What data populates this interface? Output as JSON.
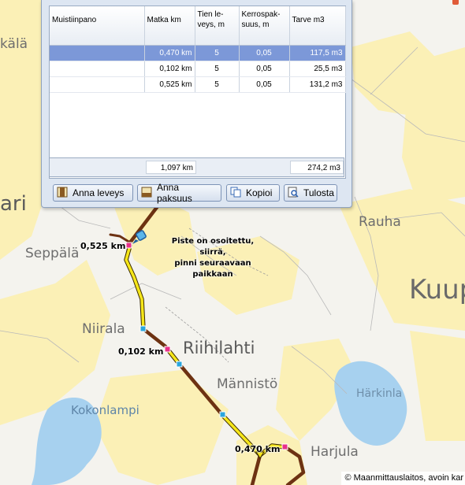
{
  "map": {
    "places": [
      {
        "id": "kala",
        "text": "kälä"
      },
      {
        "id": "ari",
        "text": "ari"
      },
      {
        "id": "seppala",
        "text": "Seppälä"
      },
      {
        "id": "rauha",
        "text": "Rauha"
      },
      {
        "id": "kuup",
        "text": "Kuup"
      },
      {
        "id": "niirala",
        "text": "Niirala"
      },
      {
        "id": "riihilahti",
        "text": "Riihilahti"
      },
      {
        "id": "mannisto",
        "text": "Männistö"
      },
      {
        "id": "harkinla",
        "text": "Härkinla"
      },
      {
        "id": "kokonlampi",
        "text": "Kokonlampi"
      },
      {
        "id": "harjula",
        "text": "Harjula"
      }
    ],
    "route_labels": {
      "a": "0,525 km",
      "b": "0,102 km",
      "c": "0,470 km"
    },
    "tooltip": {
      "line1": "Piste on osoitettu, siirrä,",
      "line2": "pinni seuraavaan paikkaan"
    },
    "copyright": "© Maanmittauslaitos, avoin kar"
  },
  "panel": {
    "columns": [
      "Muistiinpano",
      "Matka km",
      "Tien le-veys, m",
      "Kerrospak-suus, m",
      "Tarve m3"
    ],
    "column_lines": [
      [
        "Muistiinpano"
      ],
      [
        "Matka km"
      ],
      [
        "Tien le-",
        "veys, m"
      ],
      [
        "Kerrospak-",
        "suus, m"
      ],
      [
        "Tarve m3"
      ]
    ],
    "rows": [
      {
        "note": "",
        "distance": "0,470 km",
        "width": "5",
        "thickness": "0,05",
        "need": "117,5 m3",
        "selected": true
      },
      {
        "note": "",
        "distance": "0,102 km",
        "width": "5",
        "thickness": "0,05",
        "need": "25,5 m3",
        "selected": false
      },
      {
        "note": "",
        "distance": "0,525 km",
        "width": "5",
        "thickness": "0,05",
        "need": "131,2 m3",
        "selected": false
      }
    ],
    "totals": {
      "distance": "1,097 km",
      "need": "274,2 m3"
    },
    "buttons": {
      "width": "Anna leveys",
      "thickness": "Anna paksuus",
      "copy": "Kopioi",
      "print": "Tulosta"
    }
  },
  "colors": {
    "map_bg": "#f4f3ee",
    "field_yellow": "#fbf0b6",
    "water": "#a7d1ef",
    "road_brown": "#6d3212",
    "route_yellow": "#f5e619",
    "selection": "#7c98d8"
  }
}
